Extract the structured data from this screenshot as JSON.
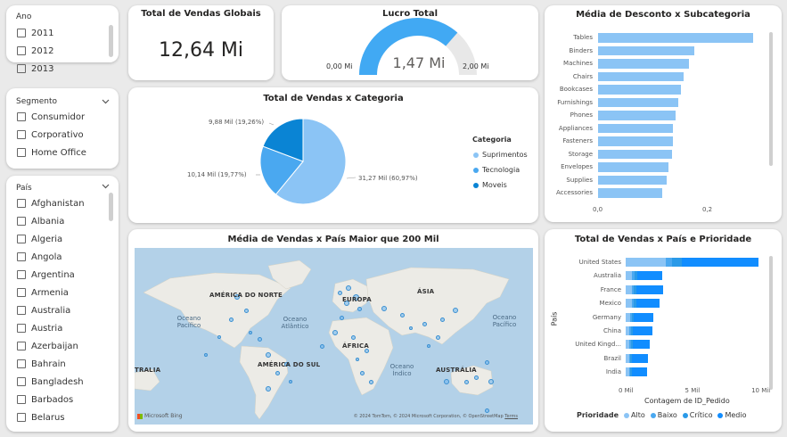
{
  "filters": {
    "ano": {
      "title": "Ano",
      "items": [
        "2011",
        "2012",
        "2013"
      ]
    },
    "segmento": {
      "title": "Segmento",
      "items": [
        "Consumidor",
        "Corporativo",
        "Home Office"
      ]
    },
    "pais": {
      "title": "País",
      "items": [
        "Afghanistan",
        "Albania",
        "Algeria",
        "Angola",
        "Argentina",
        "Armenia",
        "Australia",
        "Austria",
        "Azerbaijan",
        "Bahrain",
        "Bangladesh",
        "Barbados",
        "Belarus"
      ]
    }
  },
  "kpi": {
    "title": "Total de Vendas Globais",
    "value": "12,64 Mi"
  },
  "gauge": {
    "title": "Lucro Total",
    "value": "1,47 Mi",
    "min": "0,00 Mi",
    "max": "2,00 Mi",
    "fraction": 0.735
  },
  "pie": {
    "title": "Total de Vendas x Categoria",
    "legend_title": "Categoria",
    "labels": [
      "31,27 Mil (60,97%)",
      "10,14 Mil (19,77%)",
      "9,88 Mil (19,26%)"
    ]
  },
  "discount": {
    "title": "Média de Desconto x Subcategoria",
    "ticks": [
      "0,0",
      "0,2"
    ]
  },
  "map": {
    "title": "Média de Vendas x País Maior que 200 Mil",
    "continents": [
      "AMÉRICA DO NORTE",
      "EUROPA",
      "ÁSIA",
      "ÁFRICA",
      "AMÉRICA DO SUL",
      "AUSTRÁLIA",
      "TRALIA"
    ],
    "oceans": [
      "Oceano Pacífico",
      "Oceano Atlântico",
      "Oceano Índico",
      "Oceano Pacífico"
    ],
    "brand": "Microsoft Bing",
    "copyright": "© 2024 TomTom, © 2024 Microsoft Corporation, © OpenStreetMap",
    "terms": "Terms"
  },
  "priority": {
    "title": "Total de Vendas x País e Prioridade",
    "ylabel": "País",
    "xlabel": "Contagem de ID_Pedido",
    "ticks": [
      "0 Mil",
      "5 Mil",
      "10 Mil"
    ],
    "legend_title": "Prioridade",
    "legend": [
      "Alto",
      "Baixo",
      "Crítico",
      "Medio"
    ]
  },
  "colors": {
    "accent": "#118dff",
    "light": "#8bc4f5",
    "mid": "#4aa8f0",
    "dark": "#0a84d4",
    "gauge": "#41a9f3"
  },
  "chart_data": [
    {
      "type": "pie",
      "title": "Total de Vendas x Categoria",
      "legend_title": "Categoria",
      "categories": [
        "Suprimentos",
        "Tecnologia",
        "Moveis"
      ],
      "values": [
        31270,
        10140,
        9880
      ],
      "percent": [
        60.97,
        19.77,
        19.26
      ]
    },
    {
      "type": "bar",
      "orientation": "horizontal",
      "title": "Média de Desconto x Subcategoria",
      "categories": [
        "Tables",
        "Binders",
        "Machines",
        "Chairs",
        "Bookcases",
        "Furnishings",
        "Phones",
        "Appliances",
        "Fasteners",
        "Storage",
        "Envelopes",
        "Supplies",
        "Accessories"
      ],
      "values": [
        0.29,
        0.18,
        0.17,
        0.16,
        0.155,
        0.15,
        0.145,
        0.14,
        0.14,
        0.138,
        0.132,
        0.128,
        0.12
      ],
      "xlim": [
        0,
        0.3
      ]
    },
    {
      "type": "bar",
      "orientation": "horizontal",
      "stacked": true,
      "title": "Total de Vendas x País e Prioridade",
      "xlabel": "Contagem de ID_Pedido",
      "ylabel": "País",
      "categories": [
        "United States",
        "Australia",
        "France",
        "Mexico",
        "Germany",
        "China",
        "United Kingd...",
        "Brazil",
        "India"
      ],
      "series": [
        {
          "name": "Alto",
          "values": [
            3000,
            500,
            450,
            450,
            350,
            300,
            300,
            250,
            250
          ]
        },
        {
          "name": "Baixo",
          "values": [
            500,
            150,
            150,
            150,
            100,
            100,
            100,
            100,
            100
          ]
        },
        {
          "name": "Crítico",
          "values": [
            700,
            200,
            200,
            200,
            150,
            150,
            150,
            150,
            150
          ]
        },
        {
          "name": "Medio",
          "values": [
            5800,
            1900,
            2000,
            1750,
            1500,
            1450,
            1250,
            1150,
            1100
          ]
        }
      ],
      "xlim": [
        0,
        11000
      ]
    }
  ]
}
